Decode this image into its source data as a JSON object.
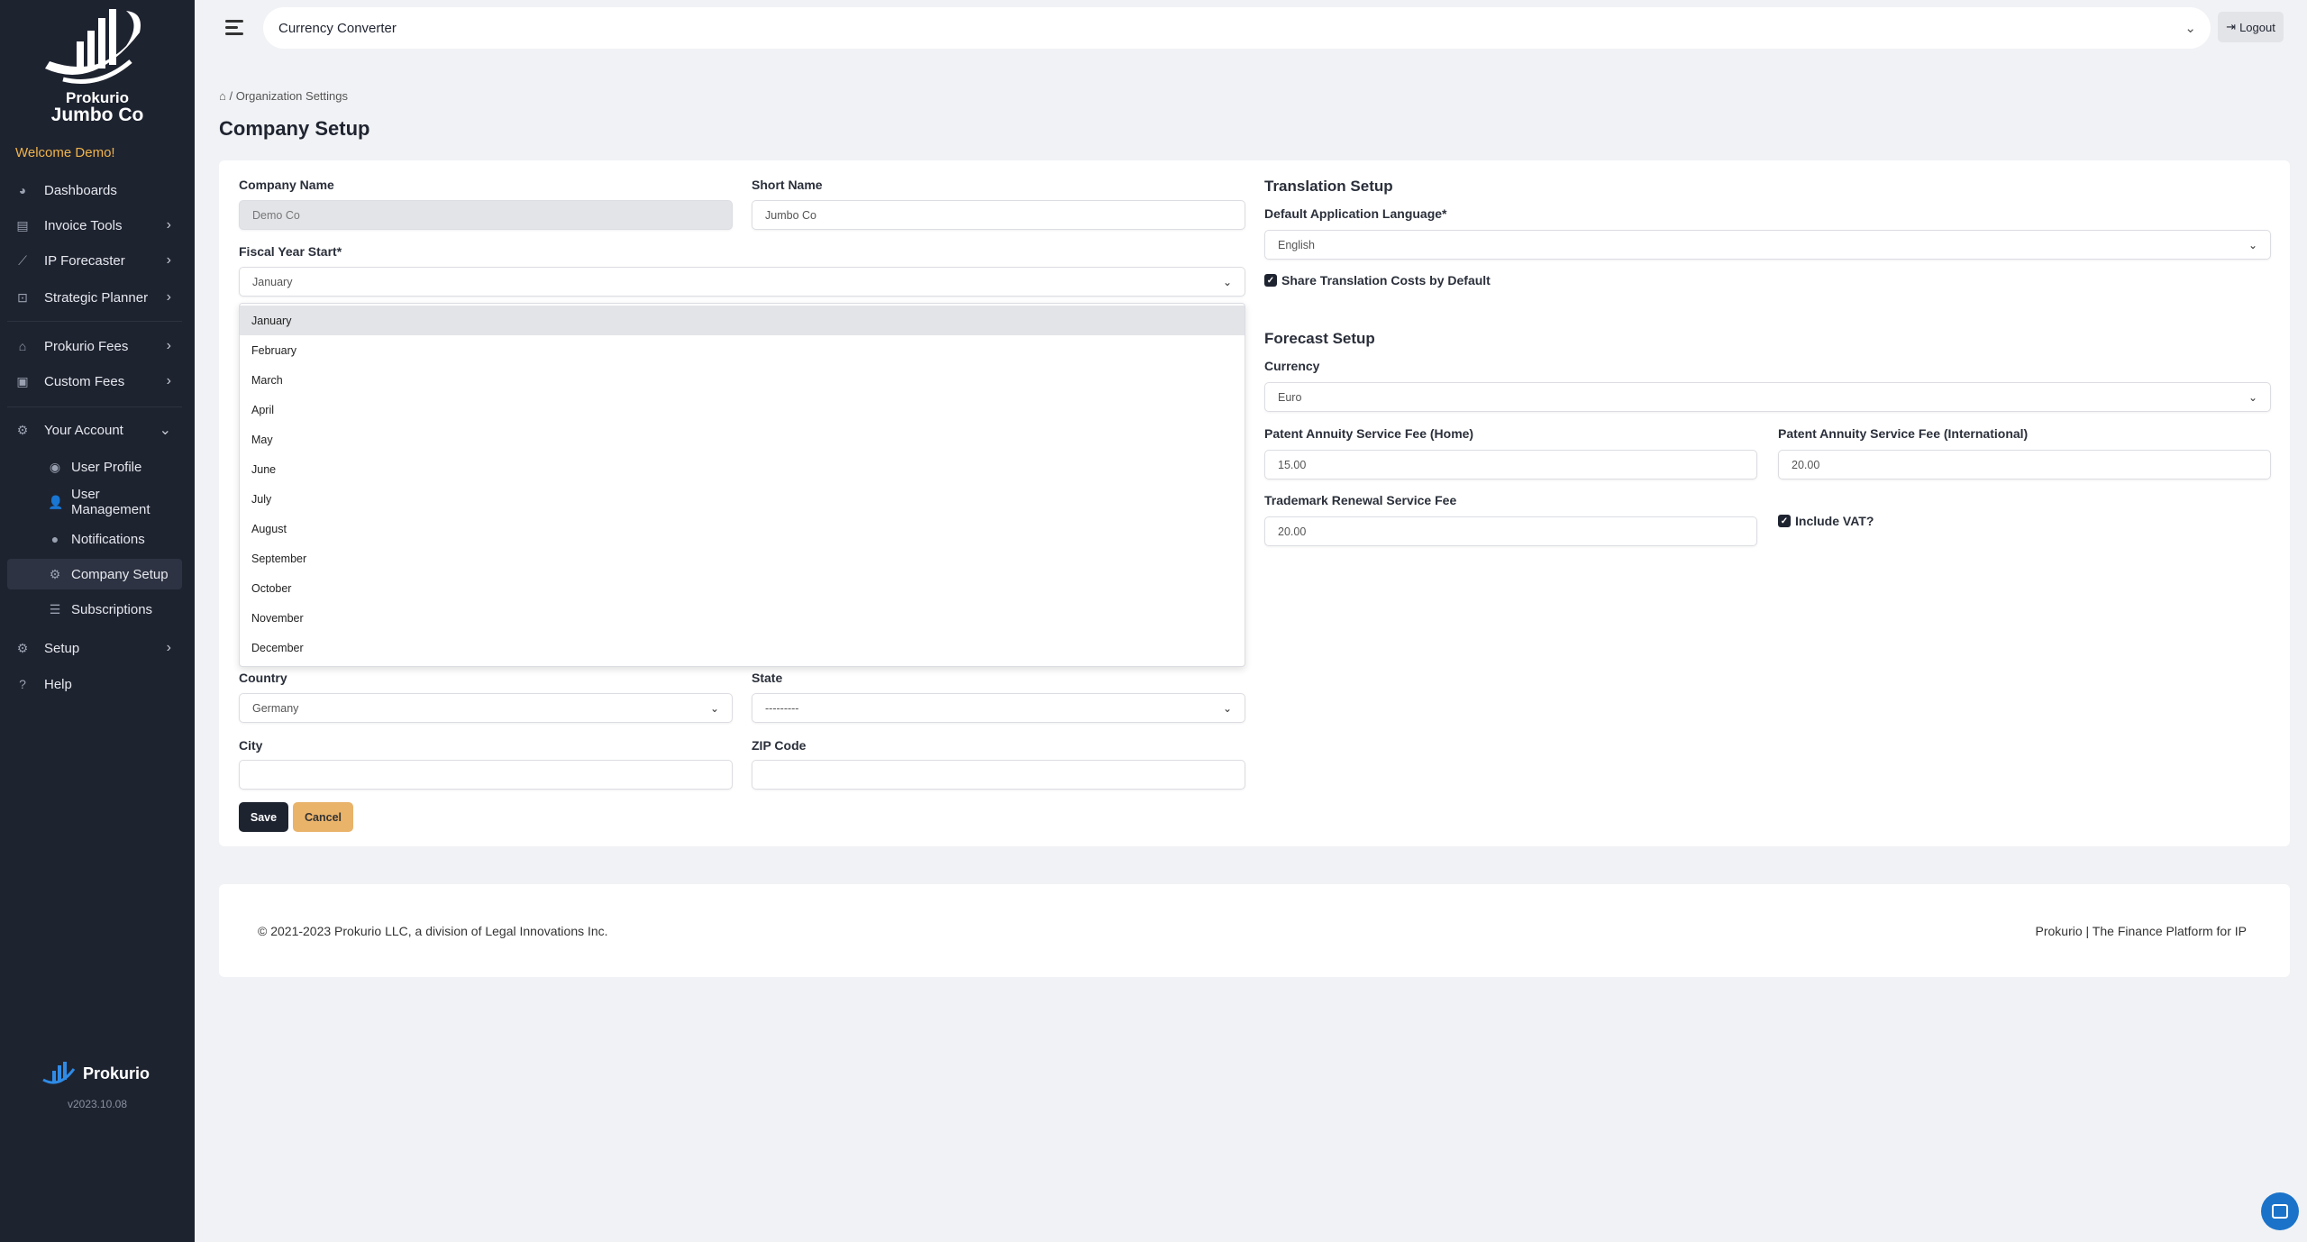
{
  "sidebar": {
    "brand_name": "Prokurio",
    "org_name": "Jumbo Co",
    "welcome": "Welcome Demo!",
    "items": [
      {
        "label": "Dashboards",
        "icon": "pie-chart-icon"
      },
      {
        "label": "Invoice Tools",
        "icon": "invoice-icon"
      },
      {
        "label": "IP Forecaster",
        "icon": "line-chart-icon"
      },
      {
        "label": "Strategic Planner",
        "icon": "planner-icon"
      },
      {
        "label": "Prokurio Fees",
        "icon": "bank-icon"
      },
      {
        "label": "Custom Fees",
        "icon": "custom-fees-icon"
      },
      {
        "label": "Your Account",
        "icon": "gear-icon"
      },
      {
        "label": "User Profile",
        "icon": "user-circle-icon"
      },
      {
        "label": "User Management",
        "icon": "user-plus-icon"
      },
      {
        "label": "Notifications",
        "icon": "alert-icon"
      },
      {
        "label": "Company Setup",
        "icon": "gear-icon"
      },
      {
        "label": "Subscriptions",
        "icon": "list-icon"
      },
      {
        "label": "Setup",
        "icon": "gear-icon"
      },
      {
        "label": "Help",
        "icon": "question-icon"
      }
    ],
    "footer_brand": "Prokurio",
    "version": "v2023.10.08"
  },
  "topbar": {
    "select_value": "Currency Converter",
    "logout": "Logout"
  },
  "breadcrumb": {
    "current": "Organization Settings"
  },
  "page_title": "Company Setup",
  "form": {
    "company_name_label": "Company Name",
    "company_name": "Demo Co",
    "short_name_label": "Short Name",
    "short_name": "Jumbo Co",
    "fiscal_label": "Fiscal Year Start*",
    "fiscal_value": "January",
    "months": [
      "January",
      "February",
      "March",
      "April",
      "May",
      "June",
      "July",
      "August",
      "September",
      "October",
      "November",
      "December"
    ],
    "country_label": "Country",
    "country": "Germany",
    "state_label": "State",
    "state": "---------",
    "city_label": "City",
    "city": "",
    "zip_label": "ZIP Code",
    "zip": "",
    "save": "Save",
    "cancel": "Cancel"
  },
  "translation": {
    "heading": "Translation Setup",
    "language_label": "Default Application Language*",
    "language": "English",
    "share_costs": "Share Translation Costs by Default",
    "share_costs_checked": true
  },
  "forecast": {
    "heading": "Forecast Setup",
    "currency_label": "Currency",
    "currency": "Euro",
    "patent_home_label": "Patent Annuity Service Fee (Home)",
    "patent_home": "15.00",
    "patent_intl_label": "Patent Annuity Service Fee (International)",
    "patent_intl": "20.00",
    "trademark_label": "Trademark Renewal Service Fee",
    "trademark": "20.00",
    "include_vat": "Include VAT?",
    "include_vat_checked": true
  },
  "footer": {
    "copyright": "© 2021-2023 Prokurio LLC, a division of Legal Innovations Inc.",
    "tagline": "Prokurio | The Finance Platform for IP"
  },
  "colors": {
    "sidebar": "#1e2330",
    "welcome": "#f0b44a",
    "save": "#1e2330",
    "cancel": "#e9b36a",
    "chat": "#1a73c9"
  }
}
